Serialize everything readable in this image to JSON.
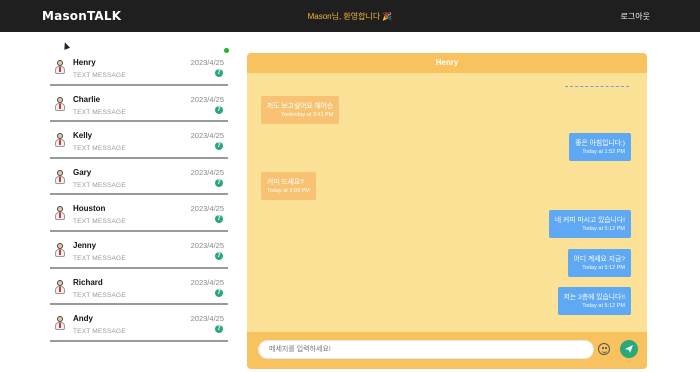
{
  "header": {
    "logo": "MasonTALK",
    "welcome": "Mason님, 환영합니다 🎉",
    "logout_label": "로그아웃"
  },
  "conversations": [
    {
      "name": "Henry",
      "preview": "TEXT MESSAGE",
      "date": "2023/4/25",
      "unread": "7",
      "online": true
    },
    {
      "name": "Charlie",
      "preview": "TEXT MESSAGE",
      "date": "2023/4/25",
      "unread": "7"
    },
    {
      "name": "Kelly",
      "preview": "TEXT MESSAGE",
      "date": "2023/4/25",
      "unread": "7"
    },
    {
      "name": "Gary",
      "preview": "TEXT MESSAGE",
      "date": "2023/4/25",
      "unread": "7"
    },
    {
      "name": "Houston",
      "preview": "TEXT MESSAGE",
      "date": "2023/4/25",
      "unread": "7"
    },
    {
      "name": "Jenny",
      "preview": "TEXT MESSAGE",
      "date": "2023/4/25",
      "unread": "7"
    },
    {
      "name": "Richard",
      "preview": "TEXT MESSAGE",
      "date": "2023/4/25",
      "unread": "7"
    },
    {
      "name": "Andy",
      "preview": "TEXT MESSAGE",
      "date": "2023/4/25",
      "unread": "7"
    }
  ],
  "chat": {
    "title": "Henry",
    "messages": [
      {
        "direction": "in",
        "text": "저도 보고싶어요 헤어순",
        "time": "Yesterday at 3:41 PM"
      },
      {
        "direction": "out",
        "text": "좋은 아침입니다:)",
        "time": "Today at 1:52 PM"
      },
      {
        "direction": "in",
        "text": "커피 드세요?",
        "time": "Today at 3:09 PM"
      },
      {
        "direction": "out",
        "text": "네 커피 마시고 있습니다!",
        "time": "Today at 5:12 PM"
      },
      {
        "direction": "out",
        "text": "어디 계세요 지금?",
        "time": "Today at 5:12 PM"
      },
      {
        "direction": "out",
        "text": "저는 3층에 있습니다!!",
        "time": "Today at 5:12 PM"
      }
    ],
    "input_placeholder": "메세지를 입력하세요!"
  },
  "colors": {
    "topbar": "#1f1f1f",
    "accent": "#f8c35e",
    "chat_bg": "#fbe297",
    "outgoing_bubble": "#5fa8f3",
    "incoming_bubble": "#f7c372",
    "badge": "#2aa87a"
  },
  "icons": {
    "emoji": "smiley-icon",
    "send": "send-icon",
    "avatar": "avatar-icon",
    "online": "online-status-icon"
  }
}
